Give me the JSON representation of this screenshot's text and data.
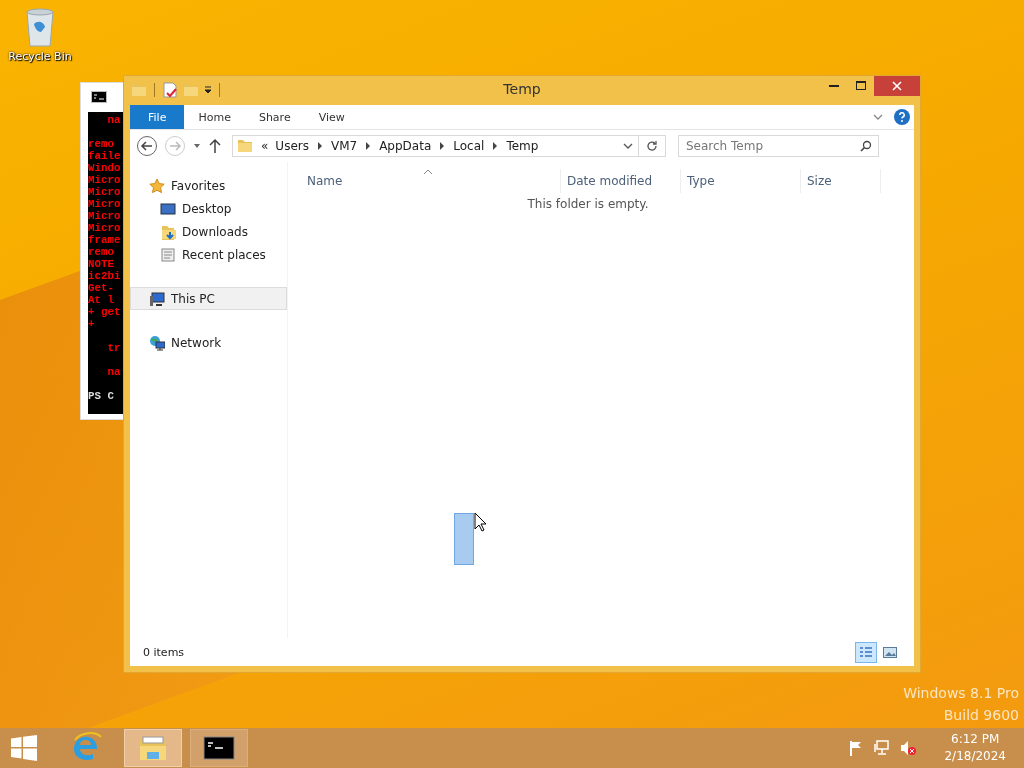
{
  "desktop_icons": [
    {
      "label": "Recycle Bin"
    }
  ],
  "console_window": {
    "lines": [
      {
        "text": "   na",
        "gap_before": false
      },
      {
        "text": "remo",
        "gap_before": true
      },
      {
        "text": "faile",
        "gap_before": false
      },
      {
        "text": "Windo",
        "gap_before": false
      },
      {
        "text": "Micro",
        "gap_before": false
      },
      {
        "text": "Micro",
        "gap_before": false
      },
      {
        "text": "Micro",
        "gap_before": false
      },
      {
        "text": "Micro",
        "gap_before": false
      },
      {
        "text": "Micro",
        "gap_before": false
      },
      {
        "text": "frame",
        "gap_before": false
      },
      {
        "text": "remo",
        "gap_before": false
      },
      {
        "text": "NOTE",
        "gap_before": false
      },
      {
        "text": "ic2bi",
        "gap_before": false
      },
      {
        "text": "Get-",
        "gap_before": false
      },
      {
        "text": "At l",
        "gap_before": false
      },
      {
        "text": "+ get",
        "gap_before": false
      },
      {
        "text": "+",
        "gap_before": false
      },
      {
        "text": "   tr",
        "gap_before": true
      },
      {
        "text": "   na",
        "gap_before": true
      },
      {
        "text": "PS C",
        "gap_before": true
      }
    ]
  },
  "explorer": {
    "title": "Temp",
    "ribbon_tabs": [
      {
        "label": "File",
        "kind": "file_menu"
      },
      {
        "label": "Home",
        "kind": "tab"
      },
      {
        "label": "Share",
        "kind": "tab"
      },
      {
        "label": "View",
        "kind": "tab"
      }
    ],
    "address": {
      "overflow": "«",
      "path": [
        "Users",
        "VM7",
        "AppData",
        "Local",
        "Temp"
      ]
    },
    "search": {
      "placeholder": "Search Temp"
    },
    "nav": [
      {
        "label": "Favorites",
        "kind": "favorites",
        "selected": false,
        "children": [
          {
            "label": "Desktop",
            "kind": "desktop",
            "selected": false
          },
          {
            "label": "Downloads",
            "kind": "downloads",
            "selected": false
          },
          {
            "label": "Recent places",
            "kind": "recent",
            "selected": false
          }
        ]
      },
      {
        "label": "This PC",
        "kind": "pc",
        "selected": true
      },
      {
        "label": "Network",
        "kind": "network",
        "selected": false
      }
    ],
    "columns": [
      {
        "label": "Name",
        "sorted": true
      },
      {
        "label": "Date modified",
        "sorted": false
      },
      {
        "label": "Type",
        "sorted": false
      },
      {
        "label": "Size",
        "sorted": false
      }
    ],
    "empty_message": "This folder is empty.",
    "status": "0 items",
    "view_buttons": [
      {
        "kind": "details",
        "selected": true
      },
      {
        "kind": "large_icons",
        "selected": false
      }
    ]
  },
  "os_version": [
    "Windows 8.1 Pro",
    "Build 9600"
  ],
  "taskbar": {
    "items": [
      {
        "kind": "ie",
        "active": false
      },
      {
        "kind": "explorer",
        "active": true
      },
      {
        "kind": "console",
        "active": false
      }
    ],
    "tray": {
      "time": "6:12 PM",
      "date": "2/18/2024"
    }
  }
}
